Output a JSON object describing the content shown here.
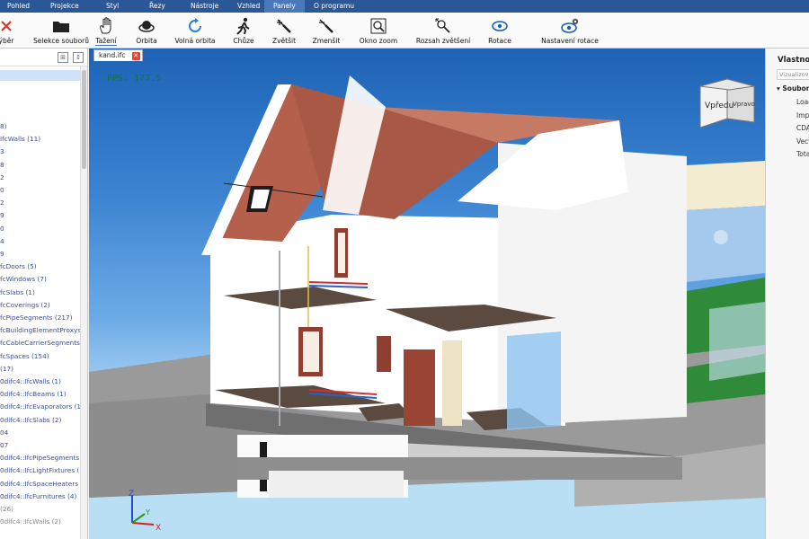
{
  "menu": [
    "Pohled",
    "Projekce",
    "Styl",
    "Řezy",
    "Nástroje",
    "Vzhled",
    "Panely",
    "O programu"
  ],
  "menu_active": "Panely",
  "toolbar": {
    "select_label": "ýběr",
    "select_files_label": "Selekce souborů",
    "pan_label": "Tažení",
    "orbit_label": "Orbita",
    "free_orbit_label": "Volná orbita",
    "walk_label": "Chůze",
    "zoom_in_label": "Zvětšit",
    "zoom_out_label": "Zmenšit",
    "zoom_window_label": "Okno zoom",
    "zoom_extents_label": "Rozsah zvětšení",
    "rotate_label": "Rotace",
    "rotate_settings_label": "Nastavení rotace"
  },
  "tree": [
    {
      "text": "8)",
      "muted": false
    },
    {
      "text": "IfcWalls (11)",
      "muted": false
    },
    {
      "text": "3",
      "muted": false
    },
    {
      "text": "8",
      "muted": false
    },
    {
      "text": "2",
      "muted": false
    },
    {
      "text": "0",
      "muted": false
    },
    {
      "text": "2",
      "muted": false
    },
    {
      "text": "9",
      "muted": false
    },
    {
      "text": "0",
      "muted": false
    },
    {
      "text": "4",
      "muted": false
    },
    {
      "text": "9",
      "muted": false
    },
    {
      "text": "fcDoors (5)",
      "muted": false
    },
    {
      "text": "fcWindows (7)",
      "muted": false
    },
    {
      "text": "fcSlabs (1)",
      "muted": false
    },
    {
      "text": "fcCoverings (2)",
      "muted": false
    },
    {
      "text": "fcPipeSegments (217)",
      "muted": false
    },
    {
      "text": "fcBuildingElementProxys",
      "muted": false
    },
    {
      "text": "fcCableCarrierSegments",
      "muted": false
    },
    {
      "text": "fcSpaces (154)",
      "muted": false
    },
    {
      "text": "(17)",
      "muted": false
    },
    {
      "text": "0difc4::IfcWalls (1)",
      "muted": false
    },
    {
      "text": "0difc4::IfcBeams (1)",
      "muted": false
    },
    {
      "text": "0difc4::IfcEvaporators (1)",
      "muted": false
    },
    {
      "text": "0difc4::IfcSlabs (2)",
      "muted": false
    },
    {
      "text": "04",
      "muted": false
    },
    {
      "text": "07",
      "muted": false
    },
    {
      "text": "0difc4::IfcPipeSegments (",
      "muted": false
    },
    {
      "text": "0difc4::IfcLightFixtures (1)",
      "muted": false
    },
    {
      "text": "0difc4::IfcSpaceHeaters (",
      "muted": false
    },
    {
      "text": "0difc4::IfcFurnitures (4)",
      "muted": false
    },
    {
      "text": "(26)",
      "muted": true
    },
    {
      "text": "0difc4::IfcWalls (2)",
      "muted": true
    }
  ],
  "document_tab": "kand.ifc",
  "fps": "FPS: 177.5",
  "viewcube": {
    "front": "Vpředu",
    "right": "Vpravo"
  },
  "axes": {
    "x": "X",
    "y": "Y",
    "z": "Z"
  },
  "properties": {
    "title": "Vlastnosti",
    "filter_placeholder": "Vizualizovat",
    "group": "Soubor",
    "items": [
      "Load",
      "Impo",
      "CDA",
      "Vect",
      "Tota"
    ]
  },
  "colors": {
    "menubar": "#2b5797",
    "roof": "#b5604c",
    "floor": "#5a4a40",
    "sky_top": "#1e63b5"
  }
}
